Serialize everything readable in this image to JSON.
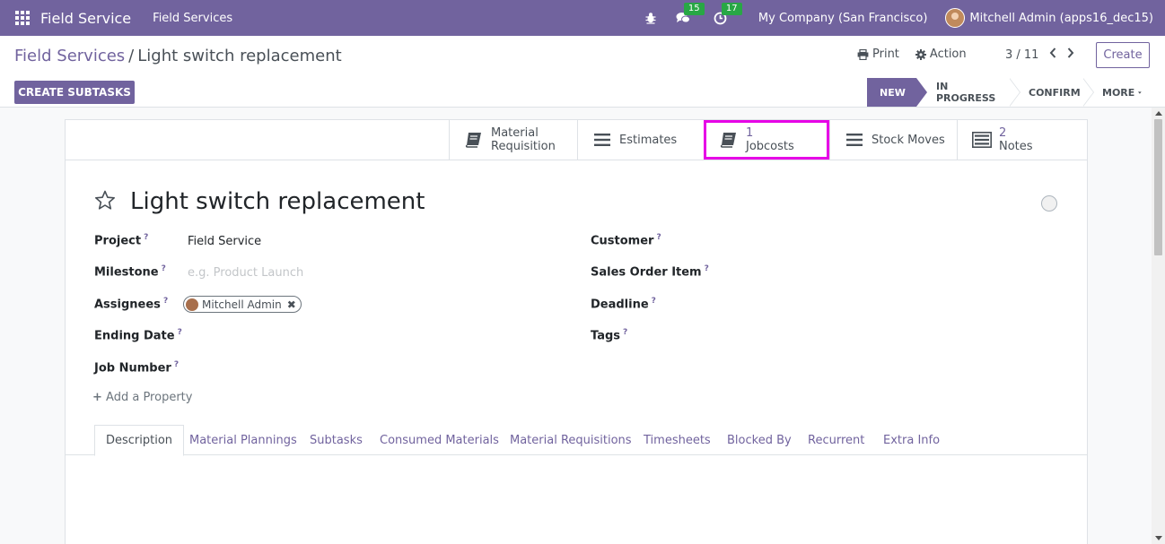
{
  "navbar": {
    "app_title": "Field Service",
    "menu_item": "Field Services",
    "messages_count": "15",
    "activities_count": "17",
    "company": "My Company (San Francisco)",
    "user": "Mitchell Admin (apps16_dec15)"
  },
  "control_panel": {
    "breadcrumb_parent": "Field Services",
    "breadcrumb_sep": "/",
    "breadcrumb_current": "Light switch replacement",
    "print_label": "Print",
    "action_label": "Action",
    "pager": "3 / 11",
    "create_label": "Create",
    "create_subtasks_label": "CREATE SUBTASKS"
  },
  "statusbar": {
    "stages": [
      "NEW",
      "IN PROGRESS",
      "CONFIRM"
    ],
    "more_label": "MORE"
  },
  "smart_buttons": {
    "material_requisition": "Material Requisition",
    "estimates": "Estimates",
    "jobcosts_count": "1",
    "jobcosts": "Jobcosts",
    "stock_moves": "Stock Moves",
    "notes_count": "2",
    "notes": "Notes"
  },
  "record": {
    "title": "Light switch replacement"
  },
  "fields": {
    "project_label": "Project",
    "project_value": "Field Service",
    "milestone_label": "Milestone",
    "milestone_placeholder": "e.g. Product Launch",
    "assignees_label": "Assignees",
    "assignee_tag": "Mitchell Admin",
    "ending_date_label": "Ending Date",
    "job_number_label": "Job Number",
    "customer_label": "Customer",
    "sales_order_item_label": "Sales Order Item",
    "deadline_label": "Deadline",
    "tags_label": "Tags",
    "help_mark": "?",
    "add_property": "Add a Property"
  },
  "tabs": [
    "Description",
    "Material Plannings",
    "Subtasks",
    "Consumed Materials",
    "Material Requisitions",
    "Timesheets",
    "Blocked By",
    "Recurrent",
    "Extra Info"
  ],
  "colors": {
    "brand": "#71639e",
    "highlight": "#e600e6",
    "badge": "#28a745"
  }
}
